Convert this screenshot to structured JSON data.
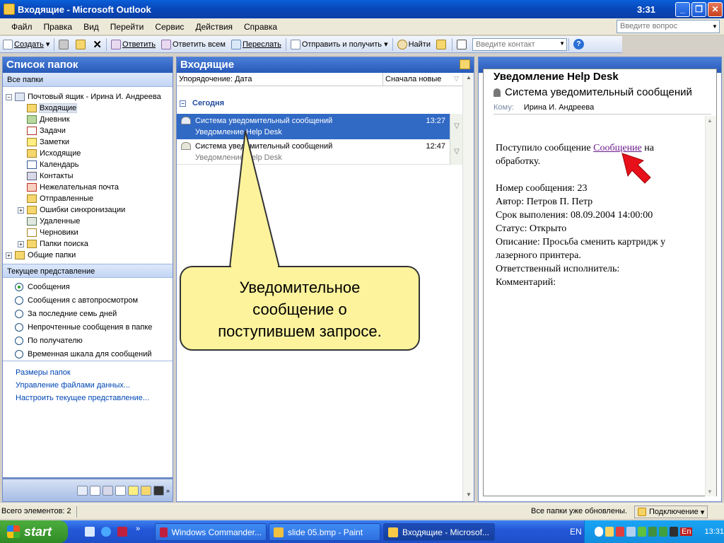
{
  "window": {
    "title": "Входящие - Microsoft Outlook",
    "clock": "3:31"
  },
  "menu": {
    "items": [
      "Файл",
      "Правка",
      "Вид",
      "Перейти",
      "Сервис",
      "Действия",
      "Справка"
    ],
    "question_placeholder": "Введите вопрос"
  },
  "toolbar": {
    "create": "Создать",
    "reply": "Ответить",
    "reply_all": "Ответить всем",
    "forward": "Переслать",
    "send_receive": "Отправить и получить",
    "find": "Найти",
    "contact_placeholder": "Введите контакт"
  },
  "folders": {
    "title": "Список папок",
    "all_folders": "Все папки",
    "mailbox": "Почтовый ящик - Ирина И. Андреева",
    "items": [
      "Входящие",
      "Дневник",
      "Задачи",
      "Заметки",
      "Исходящие",
      "Календарь",
      "Контакты",
      "Нежелательная почта",
      "Отправленные",
      "Ошибки синхронизации",
      "Удаленные",
      "Черновики",
      "Папки поиска"
    ],
    "public": "Общие папки"
  },
  "views": {
    "title": "Текущее представление",
    "items": [
      "Сообщения",
      "Сообщения с автопросмотром",
      "За последние семь дней",
      "Непрочтенные сообщения в папке",
      "По получателю",
      "Временная шкала для сообщений"
    ],
    "selected": "Сообщения"
  },
  "links": [
    "Размеры папок",
    "Управление файлами данных...",
    "Настроить текущее представление..."
  ],
  "inbox": {
    "title": "Входящие",
    "sort_label": "Упорядочение: Дата",
    "sort_order": "Сначала новые",
    "group": "Сегодня",
    "messages": [
      {
        "from": "Система уведомительный сообщений",
        "subject": "Уведомление Help Desk",
        "time": "13:27"
      },
      {
        "from": "Система уведомительный сообщений",
        "subject": "Уведомление Help Desk",
        "time": "12:47"
      }
    ]
  },
  "reading": {
    "title": "Уведомление Help Desk",
    "from": "Система уведомительный сообщений",
    "to_label": "Кому:",
    "to": "Ирина И. Андреева",
    "intro": "Поступило сообщение ",
    "link": "Сообщение",
    "intro_end": " на обработку.",
    "lines": [
      "Номер сообщения: 23",
      "Автор: Петров П. Петр",
      "Срок выполения: 08.09.2004 14:00:00",
      "Статус: Открыто",
      "Описание: Просьба сменить картридж у лазерного принтера.",
      "Ответственный исполнитель:",
      "Комментарий:"
    ]
  },
  "callout": {
    "lines": [
      "Уведомительное",
      "сообщение о",
      "поступившем запросе."
    ]
  },
  "status": {
    "count": "Всего элементов: 2",
    "updated": "Все папки уже обновлены.",
    "connection": "Подключение"
  },
  "taskbar": {
    "start": "start",
    "buttons": [
      "Windows Commander...",
      "slide 05.bmp - Paint",
      "Входящие - Microsof..."
    ],
    "lang": "EN",
    "tray_lang": "En",
    "time": "13:31"
  }
}
